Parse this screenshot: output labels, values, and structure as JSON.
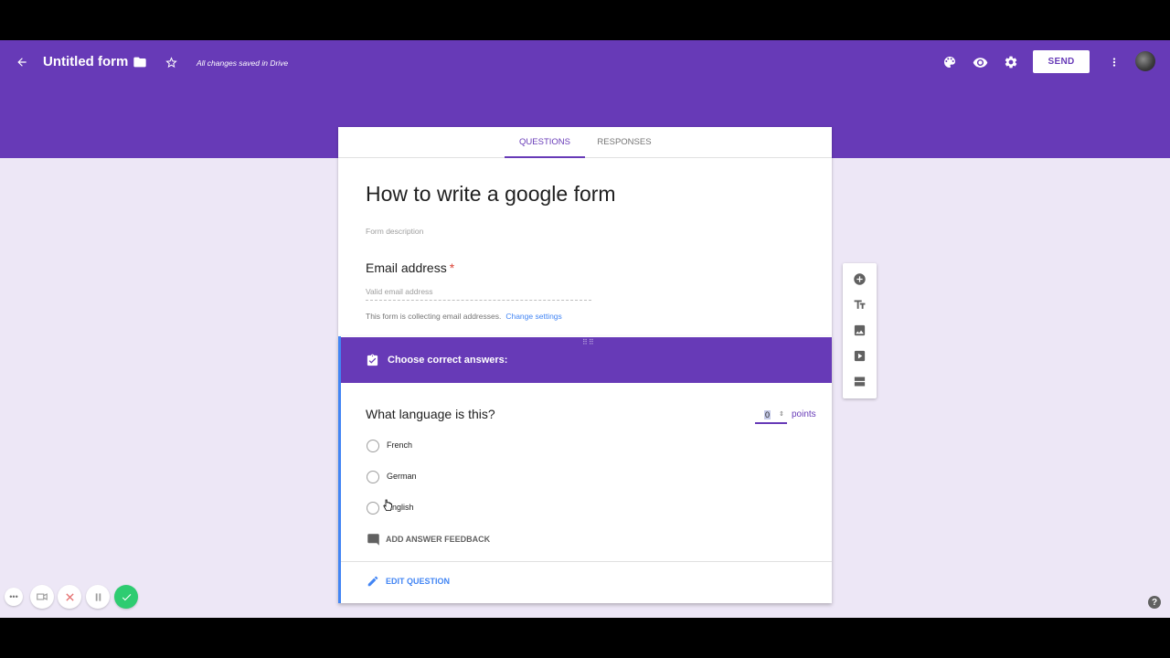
{
  "header": {
    "title": "Untitled form",
    "save_status": "All changes saved in Drive",
    "send_label": "SEND"
  },
  "tabs": [
    {
      "label": "QUESTIONS",
      "active": true
    },
    {
      "label": "RESPONSES",
      "active": false
    }
  ],
  "form": {
    "title": "How to write a google form",
    "description_placeholder": "Form description",
    "email": {
      "label": "Email address",
      "required_mark": "*",
      "placeholder": "Valid email address",
      "note": "This form is collecting email addresses.",
      "change_link": "Change settings"
    }
  },
  "question": {
    "answer_key_header": "Choose correct answers:",
    "title": "What language is this?",
    "points_value": "0",
    "points_label": "points",
    "options": [
      "French",
      "German",
      "English"
    ],
    "feedback_label": "ADD ANSWER FEEDBACK",
    "edit_label": "EDIT QUESTION"
  },
  "side_tools": [
    "add-question-icon",
    "title-text-icon",
    "image-icon",
    "video-icon",
    "section-icon"
  ],
  "help_label": "?",
  "colors": {
    "primary": "#673ab7",
    "background": "#ede7f6",
    "accent_blue": "#4285f4",
    "required_red": "#db4437",
    "recorder_green": "#2ecc71"
  }
}
